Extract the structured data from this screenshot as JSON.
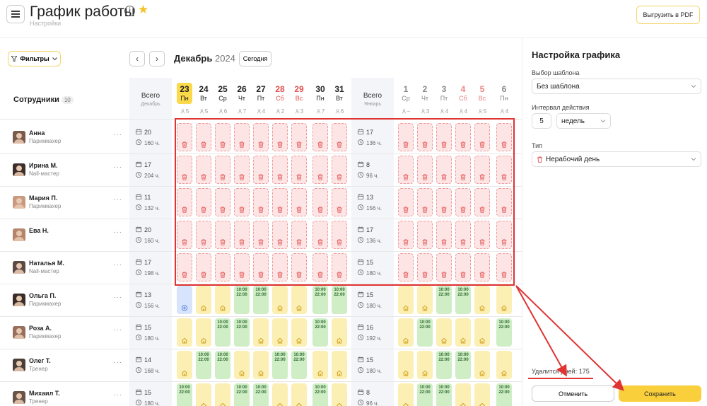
{
  "header": {
    "title": "График работы",
    "subtitle": "Настройки",
    "pdf_label": "Выгрузить в PDF"
  },
  "toolbar": {
    "filters_label": "Фильтры",
    "month": "Декабрь",
    "year": "2024",
    "today_label": "Сегодня"
  },
  "table": {
    "employees_label": "Сотрудники",
    "employees_count": "10",
    "total_dec": {
      "title": "Всего",
      "sub": "Декабрь"
    },
    "total_jan": {
      "title": "Всего",
      "sub": "Январь"
    },
    "days_dec": [
      {
        "num": "23",
        "wd": "Пн",
        "count": "5",
        "weekend": false,
        "today": true
      },
      {
        "num": "24",
        "wd": "Вт",
        "count": "5",
        "weekend": false
      },
      {
        "num": "25",
        "wd": "Ср",
        "count": "6",
        "weekend": false
      },
      {
        "num": "26",
        "wd": "Чт",
        "count": "7",
        "weekend": false
      },
      {
        "num": "27",
        "wd": "Пт",
        "count": "4",
        "weekend": false
      },
      {
        "num": "28",
        "wd": "Сб",
        "count": "2",
        "weekend": true
      },
      {
        "num": "29",
        "wd": "Вс",
        "count": "3",
        "weekend": true
      },
      {
        "num": "30",
        "wd": "Пн",
        "count": "7",
        "weekend": false
      },
      {
        "num": "31",
        "wd": "Вт",
        "count": "6",
        "weekend": false
      }
    ],
    "days_jan": [
      {
        "num": "1",
        "wd": "Ср",
        "count": "–",
        "weekend": false
      },
      {
        "num": "2",
        "wd": "Чт",
        "count": "3",
        "weekend": false
      },
      {
        "num": "3",
        "wd": "Пт",
        "count": "4",
        "weekend": false
      },
      {
        "num": "4",
        "wd": "Сб",
        "count": "4",
        "weekend": true
      },
      {
        "num": "5",
        "wd": "Вс",
        "count": "5",
        "weekend": true
      },
      {
        "num": "6",
        "wd": "Пн",
        "count": "4",
        "weekend": false
      }
    ],
    "shift_time": [
      "10:00",
      "22:00"
    ],
    "employees": [
      {
        "name": "Анна",
        "role": "Парикмахер",
        "dec_days": "20",
        "dec_hours": "160 ч.",
        "jan_days": "17",
        "jan_hours": "136 ч.",
        "dec": "XXXXXXXXX",
        "jan": "XXXXXX"
      },
      {
        "name": "Ирина М.",
        "role": "Nail-мастер",
        "dec_days": "17",
        "dec_hours": "204 ч.",
        "jan_days": "8",
        "jan_hours": "96 ч.",
        "dec": "XXXXXXXXX",
        "jan": "XXXXXX"
      },
      {
        "name": "Мария П.",
        "role": "Парикмахер",
        "dec_days": "11",
        "dec_hours": "132 ч.",
        "jan_days": "13",
        "jan_hours": "156 ч.",
        "dec": "XXXXXXXXX",
        "jan": "XXXXXX"
      },
      {
        "name": "Ева Н.",
        "role": "",
        "dec_days": "20",
        "dec_hours": "160 ч.",
        "jan_days": "17",
        "jan_hours": "136 ч.",
        "dec": "XXXXXXXXX",
        "jan": "XXXXXX"
      },
      {
        "name": "Наталья М.",
        "role": "Nail-мастер",
        "dec_days": "17",
        "dec_hours": "198 ч.",
        "jan_days": "15",
        "jan_hours": "180 ч.",
        "dec": "XXXXXXXXX",
        "jan": "XXXXXX"
      },
      {
        "name": "Ольга П.",
        "role": "Парикмахер",
        "dec_days": "13",
        "dec_hours": "156 ч.",
        "jan_days": "15",
        "jan_hours": "180 ч.",
        "dec": "BOOWWOOWW",
        "jan": "OOWWOO"
      },
      {
        "name": "Роза А.",
        "role": "Парикмахер",
        "dec_days": "15",
        "dec_hours": "180 ч.",
        "jan_days": "16",
        "jan_hours": "192 ч.",
        "dec": "OOWWOOOWO",
        "jan": "OWOOOW"
      },
      {
        "name": "Олег Т.",
        "role": "Тренер",
        "dec_days": "14",
        "dec_hours": "168 ч.",
        "jan_days": "15",
        "jan_hours": "180 ч.",
        "dec": "OWWOOWWOO",
        "jan": "OOWWOO"
      },
      {
        "name": "Михаил Т.",
        "role": "Тренер",
        "dec_days": "15",
        "dec_hours": "180 ч.",
        "jan_days": "8",
        "jan_hours": "96 ч.",
        "dec": "WOOWWOOWO",
        "jan": "OWWOOW"
      }
    ]
  },
  "panel": {
    "title": "Настройка графика",
    "template_label": "Выбор шаблона",
    "template_value": "Без шаблона",
    "interval_label": "Интервал действия",
    "interval_value": "5",
    "interval_unit": "недель",
    "type_label": "Тип",
    "type_value": "Нерабочий день",
    "delete_text": "Удалится дней: 175",
    "cancel_label": "Отменить",
    "save_label": "Сохранить"
  },
  "colors": {
    "accent": "#f9cf3c",
    "highlight": "#e03333",
    "work": "#cfeec6",
    "off": "#fcefb4",
    "delete": "#fde5e5"
  }
}
